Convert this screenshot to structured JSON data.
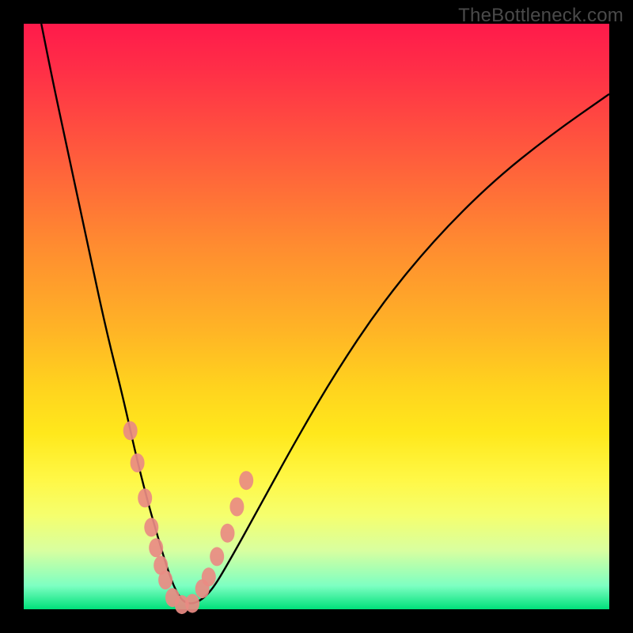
{
  "watermark": "TheBottleneck.com",
  "chart_data": {
    "type": "line",
    "title": "",
    "xlabel": "",
    "ylabel": "",
    "xlim": [
      0,
      100
    ],
    "ylim": [
      0,
      100
    ],
    "series": [
      {
        "name": "bottleneck-curve",
        "x": [
          3,
          5,
          8,
          11,
          14,
          17,
          19,
          21,
          23,
          24.5,
          26,
          27.5,
          29.5,
          32,
          35,
          40,
          46,
          53,
          61,
          70,
          80,
          90,
          100
        ],
        "values": [
          100,
          90,
          76,
          62,
          48,
          36,
          27,
          19,
          12,
          7,
          3,
          1,
          1,
          3,
          8,
          17,
          28,
          40,
          52,
          63,
          73,
          81,
          88
        ]
      }
    ],
    "markers": {
      "name": "highlight-dots",
      "x": [
        18.2,
        19.4,
        20.7,
        21.8,
        22.6,
        23.4,
        24.2,
        25.4,
        27.0,
        28.8,
        30.5,
        31.6,
        33.0,
        34.8,
        36.4,
        38.0
      ],
      "values": [
        30.5,
        25.0,
        19.0,
        14.0,
        10.5,
        7.5,
        5.0,
        2.0,
        0.8,
        1.0,
        3.5,
        5.5,
        9.0,
        13.0,
        17.5,
        22.0
      ]
    },
    "gradient": {
      "top_color": "#ff1a4b",
      "mid_color": "#ffe81c",
      "bottom_color": "#00e07a"
    }
  }
}
